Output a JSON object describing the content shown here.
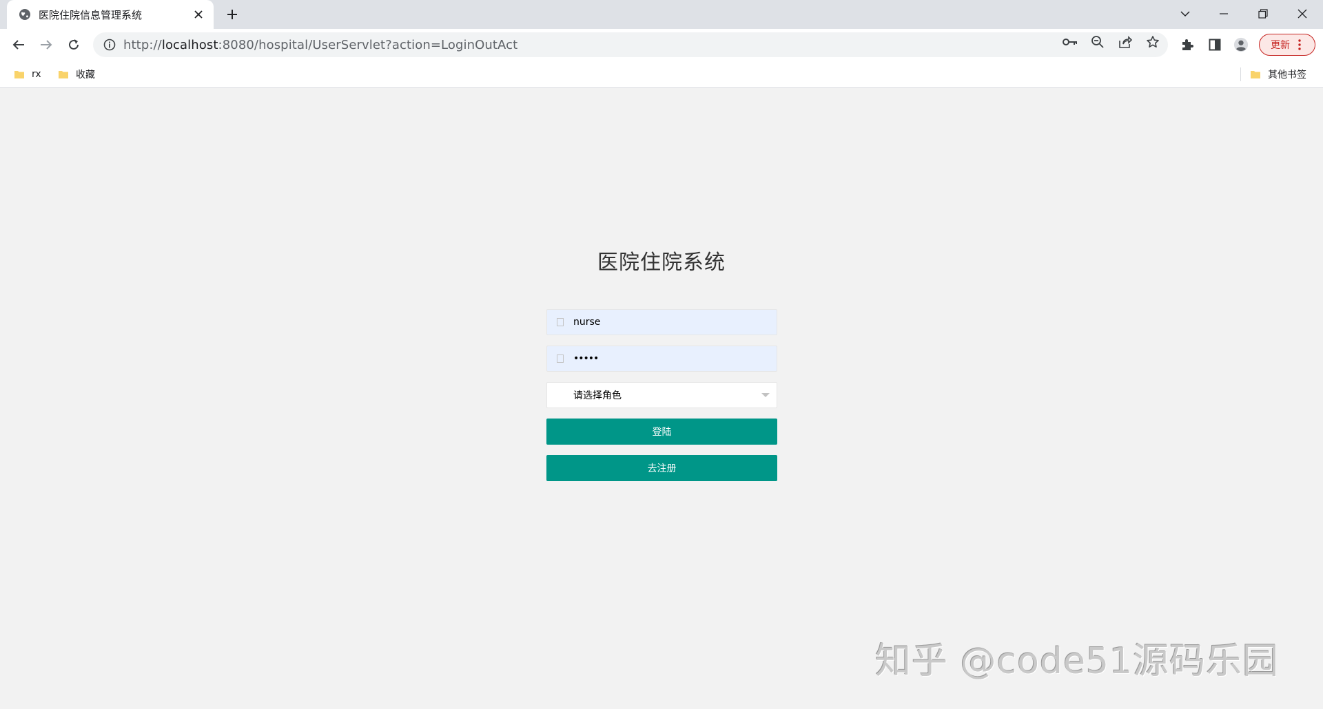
{
  "browser": {
    "tab": {
      "title": "医院住院信息管理系统"
    },
    "address": {
      "scheme": "http://",
      "host": "localhost",
      "rest": ":8080/hospital/UserServlet?action=LoginOutAct"
    },
    "update_button": {
      "label": "更新"
    },
    "bookmarks": [
      {
        "label": "rx"
      },
      {
        "label": "收藏"
      }
    ],
    "other_bookmarks": {
      "label": "其他书签"
    }
  },
  "login": {
    "title": "医院住院系统",
    "username": {
      "value": "nurse"
    },
    "password": {
      "masked": "•••••"
    },
    "role_select": {
      "selected": "请选择角色"
    },
    "login_button": "登陆",
    "register_button": "去注册"
  },
  "watermark": {
    "text": "知乎 @code51源码乐园"
  },
  "colors": {
    "primary_button": "#009688",
    "autofill_bg": "#e8f0fe",
    "page_bg": "#f2f2f2",
    "update_accent": "#c5221f"
  }
}
